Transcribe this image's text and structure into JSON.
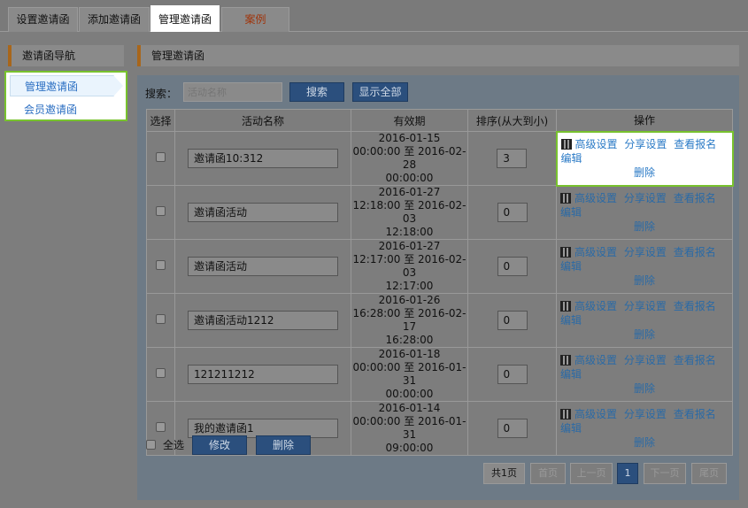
{
  "tabs": [
    {
      "label": "设置邀请函"
    },
    {
      "label": "添加邀请函"
    },
    {
      "label": "管理邀请函"
    },
    {
      "label": "案例"
    }
  ],
  "nav": {
    "title": "邀请函导航",
    "items": [
      {
        "label": "管理邀请函"
      },
      {
        "label": "会员邀请函"
      }
    ]
  },
  "main": {
    "title": "管理邀请函"
  },
  "search": {
    "label": "搜索：",
    "placeholder": "活动名称",
    "search_btn": "搜索",
    "show_all_btn": "显示全部"
  },
  "table": {
    "headers": [
      "选择",
      "活动名称",
      "有效期",
      "排序(从大到小)",
      "操作"
    ],
    "ops": {
      "advanced": "高级设置",
      "share": "分享设置",
      "view": "查看报名",
      "edit": "编辑",
      "delete": "删除"
    },
    "rows": [
      {
        "name": "邀请函10:312",
        "start": "2016-01-15",
        "line2": "00:00:00 至 2016-02-28",
        "line3": "00:00:00",
        "sort": "3"
      },
      {
        "name": "邀请函活动",
        "start": "2016-01-27",
        "line2": "12:18:00 至 2016-02-03",
        "line3": "12:18:00",
        "sort": "0"
      },
      {
        "name": "邀请函活动",
        "start": "2016-01-27",
        "line2": "12:17:00 至 2016-02-03",
        "line3": "12:17:00",
        "sort": "0"
      },
      {
        "name": "邀请函活动1212",
        "start": "2016-01-26",
        "line2": "16:28:00 至 2016-02-17",
        "line3": "16:28:00",
        "sort": "0"
      },
      {
        "name": "121211212",
        "start": "2016-01-18",
        "line2": "00:00:00 至 2016-01-31",
        "line3": "00:00:00",
        "sort": "0"
      },
      {
        "name": "我的邀请函1",
        "start": "2016-01-14",
        "line2": "00:00:00 至 2016-01-31",
        "line3": "09:00:00",
        "sort": "0"
      }
    ]
  },
  "bulk": {
    "select_all": "全选",
    "modify_btn": "修改",
    "delete_btn": "删除"
  },
  "pager": {
    "total": "共1页",
    "first": "首页",
    "prev": "上一页",
    "current": "1",
    "next": "下一页",
    "last": "尾页"
  }
}
